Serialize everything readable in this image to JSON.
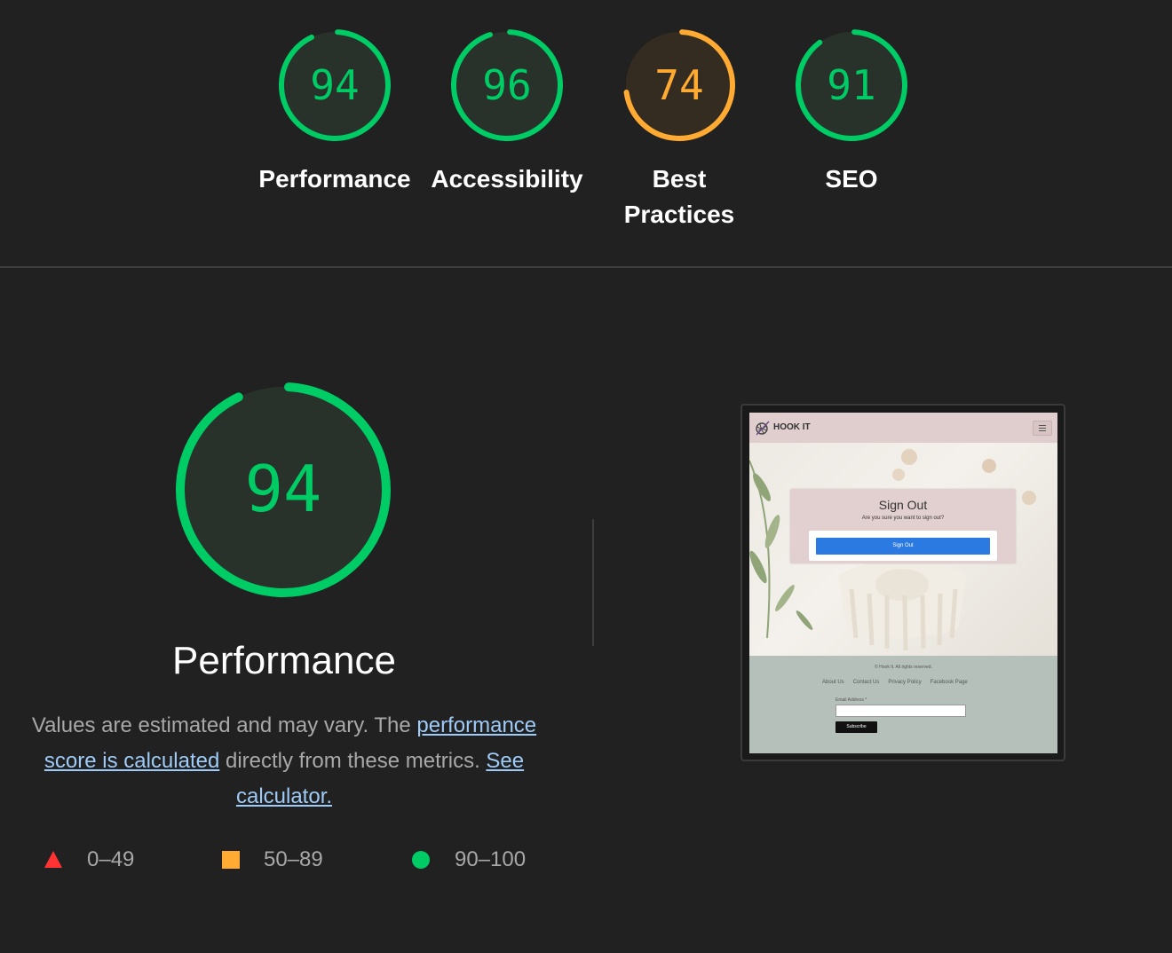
{
  "colors": {
    "pass": "#0c6",
    "pass_fill": "#28312a",
    "average": "#fa3",
    "average_fill": "#342b21",
    "fail": "#f33",
    "background": "#212121",
    "link": "#9ecbf7"
  },
  "categories": [
    {
      "label": "Performance",
      "score": 94,
      "rating": "pass"
    },
    {
      "label": "Accessibility",
      "score": 96,
      "rating": "pass"
    },
    {
      "label": "Best Practices",
      "score": 74,
      "rating": "average"
    },
    {
      "label": "SEO",
      "score": 91,
      "rating": "pass"
    }
  ],
  "performance": {
    "score": 94,
    "title": "Performance",
    "description_prefix": "Values are estimated and may vary. The ",
    "link_score": "performance score is calculated",
    "description_middle": " directly from these metrics. ",
    "link_calculator": "See calculator."
  },
  "legend": [
    {
      "shape": "triangle",
      "range": "0–49"
    },
    {
      "shape": "square",
      "range": "50–89"
    },
    {
      "shape": "circle",
      "range": "90–100"
    }
  ],
  "screenshot": {
    "brand": "HOOK IT",
    "logo_icon": "yarn-ball-icon",
    "menu_icon": "hamburger-menu-icon",
    "modal_title": "Sign Out",
    "modal_subtitle": "Are you sure you want to sign out?",
    "modal_button": "Sign Out",
    "copyright": "© Hook It. All rights reserved.",
    "footer_links": [
      "About Us",
      "Contact Us",
      "Privacy Policy",
      "Facebook Page"
    ],
    "email_label": "Email Address *",
    "subscribe": "Subscribe"
  }
}
